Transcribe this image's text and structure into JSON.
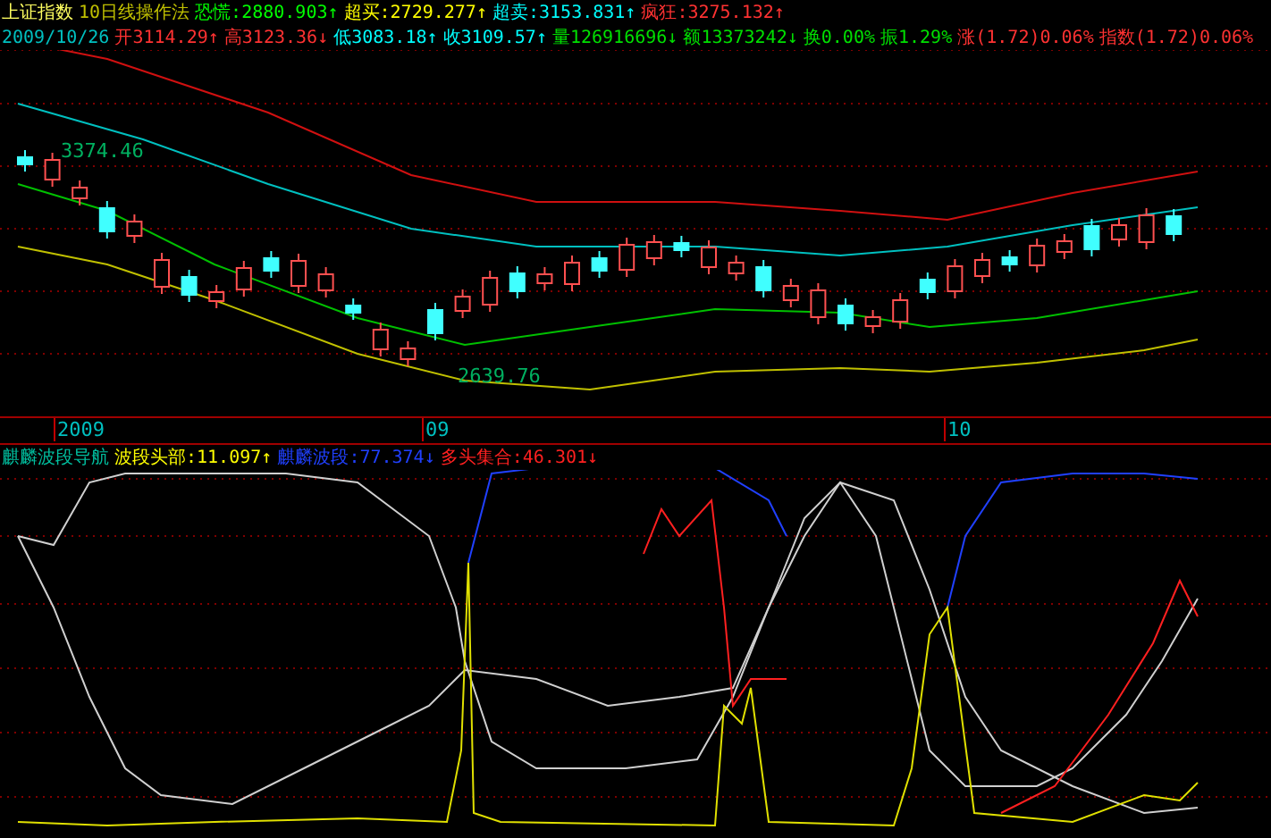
{
  "header_line_1": [
    {
      "text": "上证指数",
      "color": "#ffff60"
    },
    {
      "text": "10日线操作法",
      "color": "#c0c000"
    },
    {
      "text": "恐慌:2880.903",
      "arrow": "↑",
      "color": "#00ff00"
    },
    {
      "text": "超买:2729.277",
      "arrow": "↑",
      "color": "#ffff00"
    },
    {
      "text": "超卖:3153.831",
      "arrow": "↑",
      "color": "#00ffff"
    },
    {
      "text": "疯狂:3275.132",
      "arrow": "↑",
      "color": "#ff3232"
    }
  ],
  "header_line_2": [
    {
      "text": "2009/10/26",
      "color": "#00c0c0"
    },
    {
      "text": "开3114.29",
      "arrow": "↑",
      "color": "#ff3232"
    },
    {
      "text": "高3123.36",
      "arrow": "↓",
      "color": "#ff3232"
    },
    {
      "text": "低3083.18",
      "arrow": "↑",
      "color": "#00ffff"
    },
    {
      "text": "收3109.57",
      "arrow": "↑",
      "color": "#00ffff"
    },
    {
      "text": "量126916696",
      "arrow": "↓",
      "color": "#00e000"
    },
    {
      "text": "额13373242",
      "arrow": "↓",
      "color": "#00e000"
    },
    {
      "text": "换0.00%",
      "color": "#00e000"
    },
    {
      "text": "振1.29%",
      "color": "#00e000"
    },
    {
      "text": "涨(1.72)0.06%",
      "color": "#ff3232"
    },
    {
      "text": "指数(1.72)0.06%",
      "color": "#ff3232"
    }
  ],
  "price_labels": {
    "high": "3374.46",
    "low": "2639.76"
  },
  "time_axis": [
    {
      "label": "2009"
    },
    {
      "label": "09"
    },
    {
      "label": "10"
    }
  ],
  "indicator_header": [
    {
      "text": "麒麟波段导航",
      "color": "#00c0a0"
    },
    {
      "text": "波段头部:11.097",
      "arrow": "↑",
      "color": "#ffff00"
    },
    {
      "text": "麒麟波段:77.374",
      "arrow": "↓",
      "color": "#2040ff"
    },
    {
      "text": "多头集合:46.301",
      "arrow": "↓",
      "color": "#ff2020"
    }
  ]
}
